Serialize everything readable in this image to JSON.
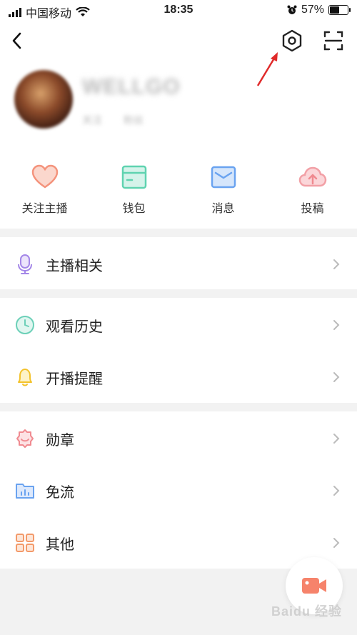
{
  "status_bar": {
    "carrier": "中国移动",
    "time": "18:35",
    "battery_percent": "57%",
    "battery_level": 0.57
  },
  "profile": {
    "nickname": "WELLGO",
    "follow_stat": "关注",
    "fans_stat": "粉丝"
  },
  "quick_actions": [
    {
      "label": "关注主播",
      "icon": "heart-icon",
      "color": "#f4937c"
    },
    {
      "label": "钱包",
      "icon": "wallet-icon",
      "color": "#5fd3b0"
    },
    {
      "label": "消息",
      "icon": "mail-icon",
      "color": "#6aa3f0"
    },
    {
      "label": "投稿",
      "icon": "cloud-upload-icon",
      "color": "#f2a0a6"
    }
  ],
  "menu": {
    "anchor_related": "主播相关",
    "watch_history": "观看历史",
    "live_reminder": "开播提醒",
    "medals": "勋章",
    "free_data": "免流",
    "others": "其他"
  },
  "colors": {
    "mic": "#a487e8",
    "clock": "#6cd0b8",
    "bell": "#f3c22b",
    "medal": "#f08a90",
    "folder": "#6aa3f0",
    "grid": "#f39a6a",
    "fab": "#f6836b",
    "arrow": "#e02a2a"
  },
  "watermark": "Baidu 经验"
}
